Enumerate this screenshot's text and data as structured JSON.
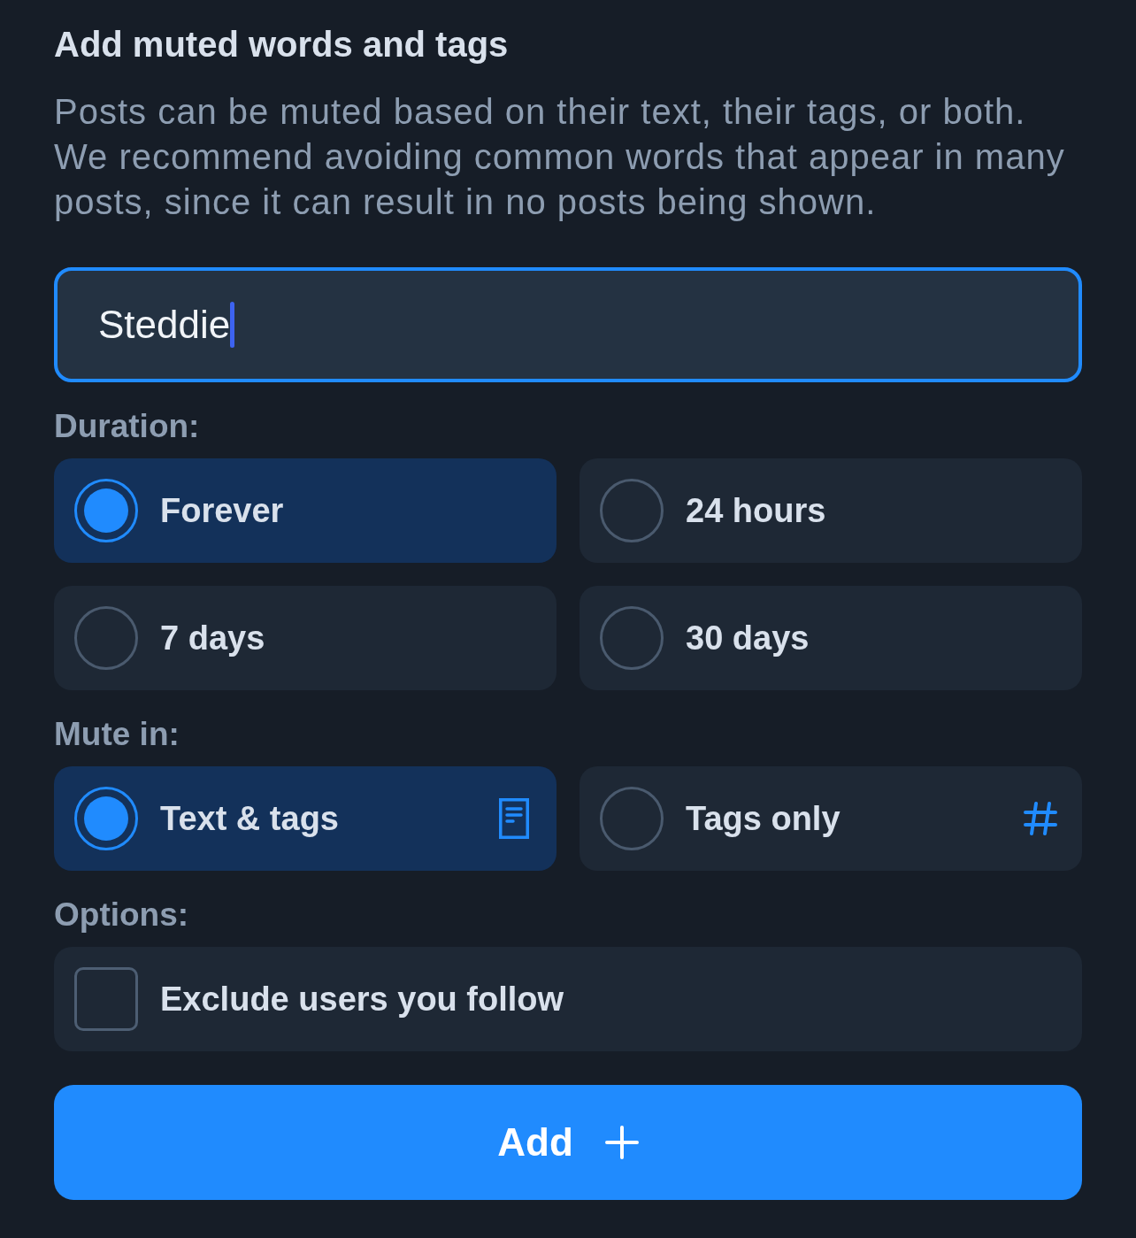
{
  "title": "Add muted words and tags",
  "description": "Posts can be muted based on their text, their tags, or both. We recommend avoiding common words that appear in many posts, since it can result in no posts being shown.",
  "input": {
    "value": "Steddie",
    "focused": true
  },
  "duration": {
    "label": "Duration:",
    "options": [
      {
        "label": "Forever",
        "selected": true
      },
      {
        "label": "24 hours",
        "selected": false
      },
      {
        "label": "7 days",
        "selected": false
      },
      {
        "label": "30 days",
        "selected": false
      }
    ]
  },
  "mute_in": {
    "label": "Mute in:",
    "options": [
      {
        "label": "Text & tags",
        "selected": true,
        "kind": "text"
      },
      {
        "label": "Tags only",
        "selected": false,
        "kind": "tags"
      }
    ]
  },
  "options": {
    "label": "Options:",
    "items": [
      {
        "label": "Exclude users you follow",
        "checked": false
      }
    ]
  },
  "button": {
    "label": "Add"
  }
}
